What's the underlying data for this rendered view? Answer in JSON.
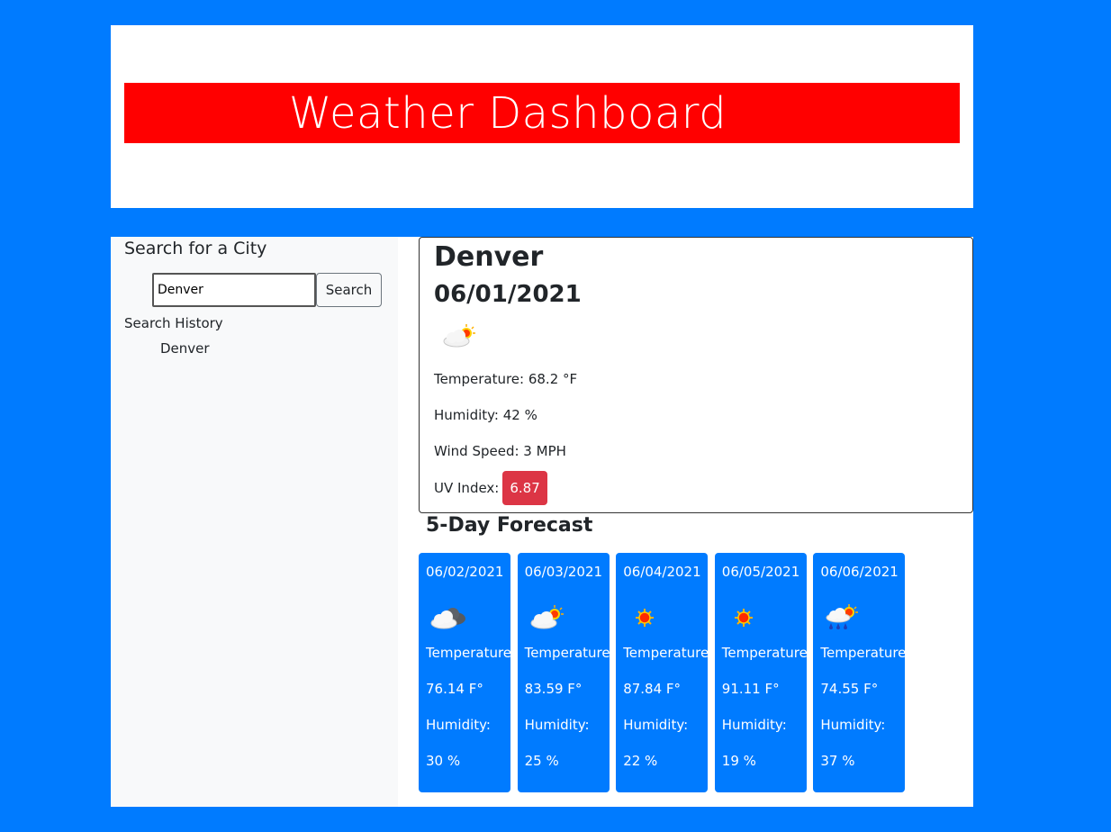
{
  "header": {
    "title": "Weather Dashboard"
  },
  "colors": {
    "page_background": "#007bff",
    "banner": "#ff0000",
    "forecast_card": "#007bff",
    "uv_badge": "#dc3545"
  },
  "sidebar": {
    "heading": "Search for a City",
    "search": {
      "value": "Denver",
      "button_label": "Search"
    },
    "history_heading": "Search History",
    "history": [
      "Denver"
    ]
  },
  "current": {
    "city": "Denver",
    "date": "06/01/2021",
    "icon": "partly-cloudy-day-icon",
    "temperature": "Temperature: 68.2 °F",
    "humidity": "Humidity: 42 %",
    "wind": "Wind Speed: 3 MPH",
    "uv_label": "UV Index:",
    "uv_value": "6.87"
  },
  "forecast": {
    "heading": "5-Day Forecast",
    "days": [
      {
        "date": "06/02/2021",
        "icon": "cloudy-icon",
        "temp_label": "Temperature:",
        "temp": "76.14 F°",
        "hum_label": "Humidity:",
        "hum": "30 %"
      },
      {
        "date": "06/03/2021",
        "icon": "partly-cloudy-day-icon",
        "temp_label": "Temperature:",
        "temp": "83.59 F°",
        "hum_label": "Humidity:",
        "hum": "25 %"
      },
      {
        "date": "06/04/2021",
        "icon": "sun-icon",
        "temp_label": "Temperature:",
        "temp": "87.84 F°",
        "hum_label": "Humidity:",
        "hum": "22 %"
      },
      {
        "date": "06/05/2021",
        "icon": "sun-icon",
        "temp_label": "Temperature:",
        "temp": "91.11 F°",
        "hum_label": "Humidity:",
        "hum": "19 %"
      },
      {
        "date": "06/06/2021",
        "icon": "rain-sun-icon",
        "temp_label": "Temperature:",
        "temp": "74.55 F°",
        "hum_label": "Humidity:",
        "hum": "37 %"
      }
    ]
  }
}
